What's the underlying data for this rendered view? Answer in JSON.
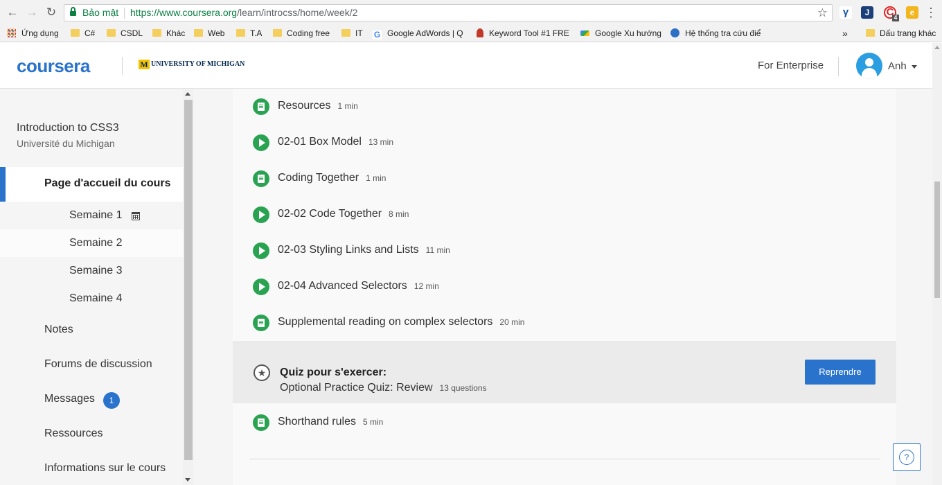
{
  "browser": {
    "secure_label": "Bảo mật",
    "url_host": "https://www.coursera.org",
    "url_path": "/learn/introcss/home/week/2",
    "extension_badge": "4",
    "bookmarks": [
      {
        "label": "Ứng dụng",
        "icon": "apps-grid-icon"
      },
      {
        "label": "C#",
        "icon": "folder-icon"
      },
      {
        "label": "CSDL",
        "icon": "folder-icon"
      },
      {
        "label": "Khác",
        "icon": "folder-icon"
      },
      {
        "label": "Web",
        "icon": "folder-icon"
      },
      {
        "label": "T.A",
        "icon": "folder-icon"
      },
      {
        "label": "Coding free",
        "icon": "folder-icon"
      },
      {
        "label": "IT",
        "icon": "folder-icon"
      },
      {
        "label": "Google AdWords | Q",
        "icon": "google-icon"
      },
      {
        "label": "Keyword Tool #1 FRE",
        "icon": "keyword-tool-icon"
      },
      {
        "label": "Google Xu hướng",
        "icon": "trends-icon"
      },
      {
        "label": "Hệ thống tra cứu điể",
        "icon": "globe-icon"
      }
    ],
    "overflow_label": "»",
    "other_bookmarks": "Dấu trang khác"
  },
  "header": {
    "logo": "coursera",
    "partner_mark": "M",
    "partner": "UNIVERSITY OF MICHIGAN",
    "enterprise_link": "For Enterprise",
    "user_name": "Anh"
  },
  "sidebar": {
    "course_title": "Introduction to CSS3",
    "course_university": "Université du Michigan",
    "home_label": "Page d'accueil du cours",
    "weeks": [
      "Semaine 1",
      "Semaine 2",
      "Semaine 3",
      "Semaine 4"
    ],
    "active_week": "Semaine 2",
    "nav": {
      "notes": "Notes",
      "forums": "Forums de discussion",
      "messages": "Messages",
      "messages_badge": "1",
      "resources": "Ressources",
      "info": "Informations sur le cours"
    }
  },
  "main": {
    "items": [
      {
        "type": "reading",
        "title": "Resources",
        "duration": "1 min"
      },
      {
        "type": "video",
        "title": "02-01 Box Model",
        "duration": "13 min"
      },
      {
        "type": "reading",
        "title": "Coding Together",
        "duration": "1 min"
      },
      {
        "type": "video",
        "title": "02-02 Code Together",
        "duration": "8 min"
      },
      {
        "type": "video",
        "title": "02-03 Styling Links and Lists",
        "duration": "11 min"
      },
      {
        "type": "video",
        "title": "02-04 Advanced Selectors",
        "duration": "12 min"
      },
      {
        "type": "reading",
        "title": "Supplemental reading on complex selectors",
        "duration": "20 min"
      }
    ],
    "quiz": {
      "label": "Quiz pour s'exercer:",
      "title": "Optional Practice Quiz: Review",
      "count": "13 questions",
      "button": "Reprendre"
    },
    "after_quiz": {
      "type": "reading",
      "title": "Shorthand rules",
      "duration": "5 min"
    },
    "help_icon_text": "?"
  },
  "colors": {
    "brand_blue": "#2a73cc",
    "complete_green": "#29a352",
    "secure_green": "#0b8043"
  }
}
